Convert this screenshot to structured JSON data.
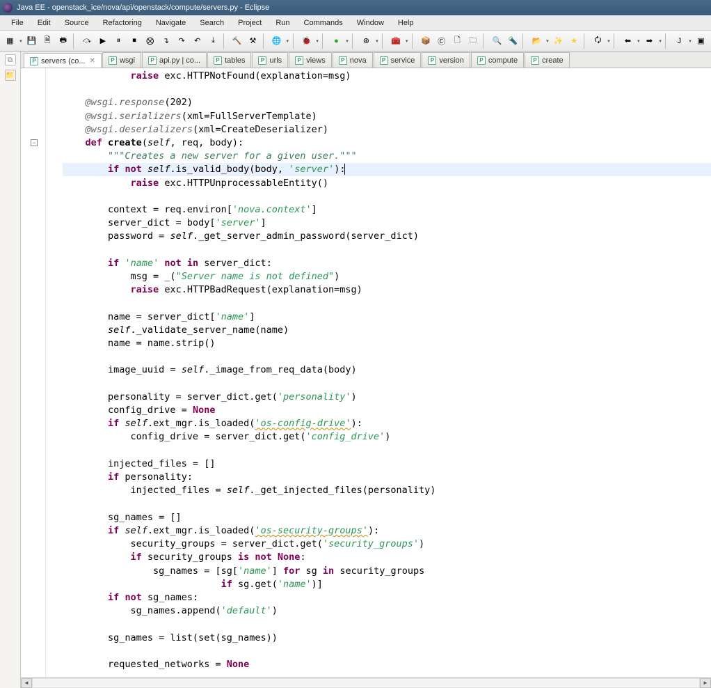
{
  "title": "Java EE - openstack_ice/nova/api/openstack/compute/servers.py - Eclipse",
  "menu": [
    "File",
    "Edit",
    "Source",
    "Refactoring",
    "Navigate",
    "Search",
    "Project",
    "Run",
    "Commands",
    "Window",
    "Help"
  ],
  "tabs": [
    {
      "label": "servers (co...",
      "active": true
    },
    {
      "label": "wsgi"
    },
    {
      "label": "api.py | co..."
    },
    {
      "label": "tables"
    },
    {
      "label": "urls"
    },
    {
      "label": "views"
    },
    {
      "label": "nova"
    },
    {
      "label": "service"
    },
    {
      "label": "version"
    },
    {
      "label": "compute"
    },
    {
      "label": "create"
    }
  ],
  "highlight_line": 7,
  "code": {
    "l1": {
      "indent": "            ",
      "t": [
        {
          "k": "kw",
          "v": "raise"
        },
        {
          "v": " exc.HTTPNotFound(explanation=msg)"
        }
      ]
    },
    "l2": {
      "indent": ""
    },
    "l3": {
      "indent": "    ",
      "t": [
        {
          "k": "dec",
          "v": "@wsgi.response"
        },
        {
          "v": "("
        },
        {
          "k": "num",
          "v": "202"
        },
        {
          "v": ")"
        }
      ]
    },
    "l4": {
      "indent": "    ",
      "t": [
        {
          "k": "dec",
          "v": "@wsgi.serializers"
        },
        {
          "v": "(xml=FullServerTemplate)"
        }
      ]
    },
    "l5": {
      "indent": "    ",
      "t": [
        {
          "k": "dec",
          "v": "@wsgi.deserializers"
        },
        {
          "v": "(xml=CreateDeserializer)"
        }
      ]
    },
    "l6": {
      "indent": "    ",
      "t": [
        {
          "k": "kw",
          "v": "def"
        },
        {
          "v": " "
        },
        {
          "k": "b",
          "v": "create"
        },
        {
          "v": "("
        },
        {
          "k": "self",
          "v": "self"
        },
        {
          "v": ", req, body):"
        }
      ],
      "fold": true
    },
    "l7": {
      "indent": "        ",
      "t": [
        {
          "k": "doc",
          "v": "\"\"\"Creates a new server for a given user.\"\"\""
        }
      ]
    },
    "l8": {
      "indent": "        ",
      "t": [
        {
          "k": "kw",
          "v": "if"
        },
        {
          "v": " "
        },
        {
          "k": "kw",
          "v": "not"
        },
        {
          "v": " "
        },
        {
          "k": "self",
          "v": "self"
        },
        {
          "v": ".is_valid_body(body, "
        },
        {
          "k": "str",
          "v": "'server'"
        },
        {
          "v": "):"
        }
      ],
      "caret": true
    },
    "l9": {
      "indent": "            ",
      "t": [
        {
          "k": "kw",
          "v": "raise"
        },
        {
          "v": " exc.HTTPUnprocessableEntity()"
        }
      ]
    },
    "l10": {
      "indent": ""
    },
    "l11": {
      "indent": "        ",
      "t": [
        {
          "v": "context = req.environ["
        },
        {
          "k": "str",
          "v": "'nova.context'"
        },
        {
          "v": "]"
        }
      ]
    },
    "l12": {
      "indent": "        ",
      "t": [
        {
          "v": "server_dict = body["
        },
        {
          "k": "str",
          "v": "'server'"
        },
        {
          "v": "]"
        }
      ]
    },
    "l13": {
      "indent": "        ",
      "t": [
        {
          "v": "password = "
        },
        {
          "k": "self",
          "v": "self"
        },
        {
          "v": "._get_server_admin_password(server_dict)"
        }
      ]
    },
    "l14": {
      "indent": ""
    },
    "l15": {
      "indent": "        ",
      "t": [
        {
          "k": "kw",
          "v": "if"
        },
        {
          "v": " "
        },
        {
          "k": "str",
          "v": "'name'"
        },
        {
          "v": " "
        },
        {
          "k": "kw",
          "v": "not"
        },
        {
          "v": " "
        },
        {
          "k": "kw",
          "v": "in"
        },
        {
          "v": " server_dict:"
        }
      ]
    },
    "l16": {
      "indent": "            ",
      "t": [
        {
          "v": "msg = _("
        },
        {
          "k": "str",
          "v": "\"Server name is not defined\""
        },
        {
          "v": ")"
        }
      ]
    },
    "l17": {
      "indent": "            ",
      "t": [
        {
          "k": "kw",
          "v": "raise"
        },
        {
          "v": " exc.HTTPBadRequest(explanation=msg)"
        }
      ]
    },
    "l18": {
      "indent": ""
    },
    "l19": {
      "indent": "        ",
      "t": [
        {
          "v": "name = server_dict["
        },
        {
          "k": "str",
          "v": "'name'"
        },
        {
          "v": "]"
        }
      ]
    },
    "l20": {
      "indent": "        ",
      "t": [
        {
          "k": "self",
          "v": "self"
        },
        {
          "v": "._validate_server_name(name)"
        }
      ]
    },
    "l21": {
      "indent": "        ",
      "t": [
        {
          "v": "name = name.strip()"
        }
      ]
    },
    "l22": {
      "indent": ""
    },
    "l23": {
      "indent": "        ",
      "t": [
        {
          "v": "image_uuid = "
        },
        {
          "k": "self",
          "v": "self"
        },
        {
          "v": "._image_from_req_data(body)"
        }
      ]
    },
    "l24": {
      "indent": ""
    },
    "l25": {
      "indent": "        ",
      "t": [
        {
          "v": "personality = server_dict.get("
        },
        {
          "k": "str",
          "v": "'personality'"
        },
        {
          "v": ")"
        }
      ]
    },
    "l26": {
      "indent": "        ",
      "t": [
        {
          "v": "config_drive = "
        },
        {
          "k": "const",
          "v": "None"
        }
      ]
    },
    "l27": {
      "indent": "        ",
      "t": [
        {
          "k": "kw",
          "v": "if"
        },
        {
          "v": " "
        },
        {
          "k": "self",
          "v": "self"
        },
        {
          "v": ".ext_mgr.is_loaded("
        },
        {
          "k": "str squig",
          "v": "'os-config-drive'"
        },
        {
          "v": "):"
        }
      ]
    },
    "l28": {
      "indent": "            ",
      "t": [
        {
          "v": "config_drive = server_dict.get("
        },
        {
          "k": "str",
          "v": "'config_drive'"
        },
        {
          "v": ")"
        }
      ]
    },
    "l29": {
      "indent": ""
    },
    "l30": {
      "indent": "        ",
      "t": [
        {
          "v": "injected_files = []"
        }
      ]
    },
    "l31": {
      "indent": "        ",
      "t": [
        {
          "k": "kw",
          "v": "if"
        },
        {
          "v": " personality:"
        }
      ]
    },
    "l32": {
      "indent": "            ",
      "t": [
        {
          "v": "injected_files = "
        },
        {
          "k": "self",
          "v": "self"
        },
        {
          "v": "._get_injected_files(personality)"
        }
      ]
    },
    "l33": {
      "indent": ""
    },
    "l34": {
      "indent": "        ",
      "t": [
        {
          "v": "sg_names = []"
        }
      ]
    },
    "l35": {
      "indent": "        ",
      "t": [
        {
          "k": "kw",
          "v": "if"
        },
        {
          "v": " "
        },
        {
          "k": "self",
          "v": "self"
        },
        {
          "v": ".ext_mgr.is_loaded("
        },
        {
          "k": "str squig",
          "v": "'os-security-groups'"
        },
        {
          "v": "):"
        }
      ]
    },
    "l36": {
      "indent": "            ",
      "t": [
        {
          "v": "security_groups = server_dict.get("
        },
        {
          "k": "str",
          "v": "'security_groups'"
        },
        {
          "v": ")"
        }
      ]
    },
    "l37": {
      "indent": "            ",
      "t": [
        {
          "k": "kw",
          "v": "if"
        },
        {
          "v": " security_groups "
        },
        {
          "k": "kw",
          "v": "is"
        },
        {
          "v": " "
        },
        {
          "k": "kw",
          "v": "not"
        },
        {
          "v": " "
        },
        {
          "k": "const",
          "v": "None"
        },
        {
          "v": ":"
        }
      ]
    },
    "l38": {
      "indent": "                ",
      "t": [
        {
          "v": "sg_names = [sg["
        },
        {
          "k": "str",
          "v": "'name'"
        },
        {
          "v": "] "
        },
        {
          "k": "kw",
          "v": "for"
        },
        {
          "v": " sg "
        },
        {
          "k": "kw",
          "v": "in"
        },
        {
          "v": " security_groups"
        }
      ]
    },
    "l39": {
      "indent": "                            ",
      "t": [
        {
          "k": "kw",
          "v": "if"
        },
        {
          "v": " sg.get("
        },
        {
          "k": "str",
          "v": "'name'"
        },
        {
          "v": ")]"
        }
      ]
    },
    "l40": {
      "indent": "        ",
      "t": [
        {
          "k": "kw",
          "v": "if"
        },
        {
          "v": " "
        },
        {
          "k": "kw",
          "v": "not"
        },
        {
          "v": " sg_names:"
        }
      ]
    },
    "l41": {
      "indent": "            ",
      "t": [
        {
          "v": "sg_names.append("
        },
        {
          "k": "str",
          "v": "'default'"
        },
        {
          "v": ")"
        }
      ]
    },
    "l42": {
      "indent": ""
    },
    "l43": {
      "indent": "        ",
      "t": [
        {
          "v": "sg_names = list(set(sg_names))"
        }
      ]
    },
    "l44": {
      "indent": ""
    },
    "l45": {
      "indent": "        ",
      "t": [
        {
          "v": "requested_networks = "
        },
        {
          "k": "const",
          "v": "None"
        }
      ]
    }
  },
  "toolbar_icons": [
    "new",
    "save",
    "saveall",
    "print",
    "|",
    "dbg-skip",
    "dbg-resume",
    "dbg-pause",
    "dbg-stop",
    "dbg-disc",
    "dbg-stepi",
    "dbg-stepo",
    "dbg-stepr",
    "dbg-drop",
    "|",
    "build",
    "buildall",
    "|",
    "globe",
    "|",
    "bug",
    "|",
    "run",
    "|",
    "runext",
    "|",
    "tools",
    "|",
    "newpkg",
    "newcls",
    "newfile",
    "newfold",
    "|",
    "search",
    "torch",
    "|",
    "open",
    "wand",
    "star",
    "|",
    "sync",
    "|",
    "back",
    "fwd",
    "|",
    "persp-j",
    "persp-d"
  ]
}
